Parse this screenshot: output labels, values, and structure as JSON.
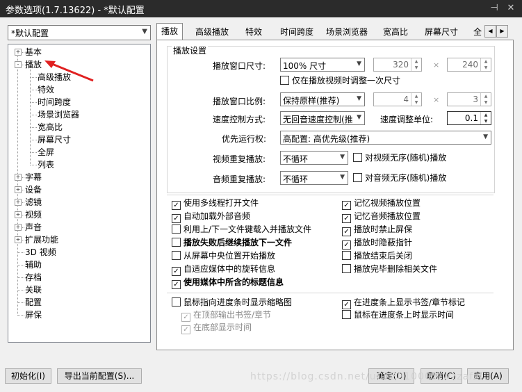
{
  "window": {
    "title": "参数选项(1.7.13622) - *默认配置",
    "pin_icon": "pin-icon",
    "close_icon": "close-icon"
  },
  "profile": {
    "selected": "*默认配置"
  },
  "tree": {
    "items": [
      {
        "label": "基本",
        "level": 0,
        "expander": "+"
      },
      {
        "label": "播放",
        "level": 0,
        "expander": "-"
      },
      {
        "label": "高级播放",
        "level": 1
      },
      {
        "label": "特效",
        "level": 1
      },
      {
        "label": "时间跨度",
        "level": 1
      },
      {
        "label": "场景浏览器",
        "level": 1
      },
      {
        "label": "宽高比",
        "level": 1
      },
      {
        "label": "屏幕尺寸",
        "level": 1
      },
      {
        "label": "全屏",
        "level": 1
      },
      {
        "label": "列表",
        "level": 1
      },
      {
        "label": "字幕",
        "level": 0,
        "expander": "+"
      },
      {
        "label": "设备",
        "level": 0,
        "expander": "+"
      },
      {
        "label": "滤镜",
        "level": 0,
        "expander": "+"
      },
      {
        "label": "视频",
        "level": 0,
        "expander": "+"
      },
      {
        "label": "声音",
        "level": 0,
        "expander": "+"
      },
      {
        "label": "扩展功能",
        "level": 0,
        "expander": "+"
      },
      {
        "label": "3D 视频",
        "level": 0
      },
      {
        "label": "辅助",
        "level": 0
      },
      {
        "label": "存档",
        "level": 0
      },
      {
        "label": "关联",
        "level": 0
      },
      {
        "label": "配置",
        "level": 0
      },
      {
        "label": "屏保",
        "level": 0
      }
    ]
  },
  "tabs": [
    "播放",
    "高级播放",
    "特效",
    "时间跨度",
    "场景浏览器",
    "宽高比",
    "屏幕尺寸",
    "全"
  ],
  "playback": {
    "group_title": "播放设置",
    "window_size_label": "播放窗口尺寸:",
    "window_size_value": "100% 尺寸",
    "width": "320",
    "height": "240",
    "times1": "×",
    "times2": "×",
    "adjust_once": "仅在播放视频时调整一次尺寸",
    "ratio_label": "播放窗口比例:",
    "ratio_value": "保持原样(推荐)",
    "ratio_w": "4",
    "ratio_h": "3",
    "speed_mode_label": "速度控制方式:",
    "speed_mode_value": "无回音速度控制(推",
    "speed_unit_label": "速度调整单位:",
    "speed_unit_value": "0.1",
    "priority_label": "优先运行权:",
    "priority_value": "高配置: 高优先级(推荐)",
    "video_repeat_label": "视频重复播放:",
    "video_repeat_value": "不循环",
    "video_shuffle": "对视频无序(随机)播放",
    "audio_repeat_label": "音频重复播放:",
    "audio_repeat_value": "不循环",
    "audio_shuffle": "对音频无序(随机)播放"
  },
  "options_left": [
    {
      "label": "使用多线程打开文件",
      "checked": true
    },
    {
      "label": "自动加载外部音频",
      "checked": true
    },
    {
      "label": "利用上/下一文件键载入并播放文件",
      "checked": false
    },
    {
      "label": "播放失败后继续播放下一文件",
      "checked": false,
      "bold": true
    },
    {
      "label": "从屏幕中央位置开始播放",
      "checked": false
    },
    {
      "label": "自适应媒体中的旋转信息",
      "checked": true
    },
    {
      "label": "使用媒体中所含的标题信息",
      "checked": true,
      "bold": true
    }
  ],
  "options_right": [
    {
      "label": "记忆视频播放位置",
      "checked": true
    },
    {
      "label": "记忆音频播放位置",
      "checked": true
    },
    {
      "label": "播放时禁止屏保",
      "checked": true
    },
    {
      "label": "播放时隐蔽指针",
      "checked": true
    },
    {
      "label": "播放结束后关闭",
      "checked": false
    },
    {
      "label": "播放完毕删除相关文件",
      "checked": false
    }
  ],
  "seek": {
    "thumbnail": "鼠标指向进度条时显示缩略图",
    "top_output": "在顶部输出书签/章节",
    "bottom_time": "在底部显示时间",
    "show_bookmarks": "在进度条上显示书签/章节标记",
    "show_time": "鼠标在进度条上时显示时间"
  },
  "buttons": {
    "init": "初始化(I)",
    "export": "导出当前配置(S)...",
    "ok": "确定(O)",
    "cancel": "取消(C)",
    "apply": "应用(A)"
  },
  "watermark": "https://blog.csdn.net/u012010002/wzzafzf",
  "colors": {
    "annotation_arrow": "#e02020",
    "title_bar": "#2b2b2b"
  }
}
